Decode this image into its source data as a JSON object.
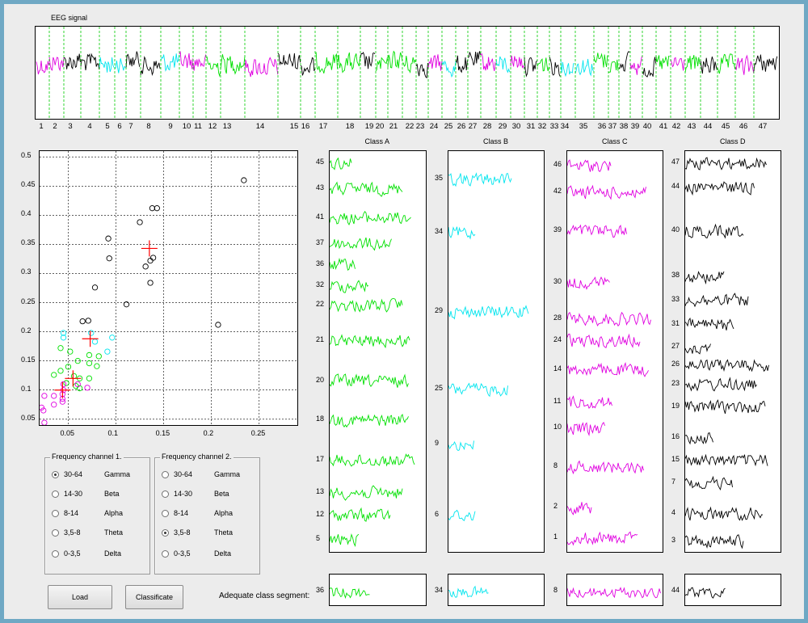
{
  "eeg": {
    "title": "EEG signal",
    "segments": [
      {
        "label": "1",
        "cls": "C"
      },
      {
        "label": "2",
        "cls": "C"
      },
      {
        "label": "3",
        "cls": "D"
      },
      {
        "label": "4",
        "cls": "D"
      },
      {
        "label": "5",
        "cls": "B"
      },
      {
        "label": "6",
        "cls": "B"
      },
      {
        "label": "7",
        "cls": "D"
      },
      {
        "label": "8",
        "cls": "D"
      },
      {
        "label": "9",
        "cls": "B"
      },
      {
        "label": "10",
        "cls": "C"
      },
      {
        "label": "11",
        "cls": "C"
      },
      {
        "label": "12",
        "cls": "A"
      },
      {
        "label": "13",
        "cls": "A"
      },
      {
        "label": "14",
        "cls": "C"
      },
      {
        "label": "15",
        "cls": "D"
      },
      {
        "label": "16",
        "cls": "D"
      },
      {
        "label": "17",
        "cls": "A"
      },
      {
        "label": "18",
        "cls": "A"
      },
      {
        "label": "19",
        "cls": "D"
      },
      {
        "label": "20",
        "cls": "A"
      },
      {
        "label": "21",
        "cls": "A"
      },
      {
        "label": "22",
        "cls": "A"
      },
      {
        "label": "23",
        "cls": "D"
      },
      {
        "label": "24",
        "cls": "C"
      },
      {
        "label": "25",
        "cls": "B"
      },
      {
        "label": "26",
        "cls": "D"
      },
      {
        "label": "27",
        "cls": "D"
      },
      {
        "label": "28",
        "cls": "C"
      },
      {
        "label": "29",
        "cls": "B"
      },
      {
        "label": "30",
        "cls": "C"
      },
      {
        "label": "31",
        "cls": "D"
      },
      {
        "label": "32",
        "cls": "A"
      },
      {
        "label": "33",
        "cls": "D"
      },
      {
        "label": "34",
        "cls": "B"
      },
      {
        "label": "35",
        "cls": "B"
      },
      {
        "label": "36",
        "cls": "A"
      },
      {
        "label": "37",
        "cls": "A"
      },
      {
        "label": "38",
        "cls": "D"
      },
      {
        "label": "39",
        "cls": "C"
      },
      {
        "label": "40",
        "cls": "D"
      },
      {
        "label": "41",
        "cls": "A"
      },
      {
        "label": "42",
        "cls": "C"
      },
      {
        "label": "43",
        "cls": "A"
      },
      {
        "label": "44",
        "cls": "D"
      },
      {
        "label": "45",
        "cls": "A"
      },
      {
        "label": "46",
        "cls": "C"
      },
      {
        "label": "47",
        "cls": "D"
      }
    ]
  },
  "colors": {
    "A": "#00e000",
    "B": "#00e5ee",
    "C": "#e000e0",
    "D": "#000000",
    "centroid": "#ff0000"
  },
  "scatter": {
    "x_ticks": [
      "0.05",
      "0.1",
      "0.15",
      "0.2",
      "0.25"
    ],
    "y_ticks": [
      "0.5",
      "0.45",
      "0.4",
      "0.35",
      "0.3",
      "0.25",
      "0.2",
      "0.15",
      "0.1",
      "0.05"
    ],
    "xlim": [
      0.02,
      0.29
    ],
    "ylim": [
      0.04,
      0.51
    ],
    "grid": true,
    "points": [
      {
        "c": "D",
        "x": 0.234,
        "y": 0.46
      },
      {
        "c": "D",
        "x": 0.138,
        "y": 0.412
      },
      {
        "c": "D",
        "x": 0.143,
        "y": 0.412
      },
      {
        "c": "D",
        "x": 0.125,
        "y": 0.388
      },
      {
        "c": "D",
        "x": 0.092,
        "y": 0.36
      },
      {
        "c": "D",
        "x": 0.093,
        "y": 0.326
      },
      {
        "c": "D",
        "x": 0.131,
        "y": 0.312
      },
      {
        "c": "D",
        "x": 0.136,
        "y": 0.322
      },
      {
        "c": "D",
        "x": 0.139,
        "y": 0.327
      },
      {
        "c": "D",
        "x": 0.136,
        "y": 0.284
      },
      {
        "c": "D",
        "x": 0.078,
        "y": 0.276
      },
      {
        "c": "D",
        "x": 0.111,
        "y": 0.247
      },
      {
        "c": "D",
        "x": 0.065,
        "y": 0.218
      },
      {
        "c": "D",
        "x": 0.071,
        "y": 0.219
      },
      {
        "c": "D",
        "x": 0.207,
        "y": 0.212
      },
      {
        "c": "B",
        "x": 0.045,
        "y": 0.198
      },
      {
        "c": "B",
        "x": 0.074,
        "y": 0.198
      },
      {
        "c": "B",
        "x": 0.045,
        "y": 0.19
      },
      {
        "c": "B",
        "x": 0.096,
        "y": 0.19
      },
      {
        "c": "B",
        "x": 0.078,
        "y": 0.183
      },
      {
        "c": "B",
        "x": 0.091,
        "y": 0.166
      },
      {
        "c": "A",
        "x": 0.042,
        "y": 0.172
      },
      {
        "c": "A",
        "x": 0.052,
        "y": 0.166
      },
      {
        "c": "A",
        "x": 0.072,
        "y": 0.16
      },
      {
        "c": "A",
        "x": 0.082,
        "y": 0.158
      },
      {
        "c": "A",
        "x": 0.06,
        "y": 0.15
      },
      {
        "c": "A",
        "x": 0.072,
        "y": 0.146
      },
      {
        "c": "A",
        "x": 0.08,
        "y": 0.141
      },
      {
        "c": "A",
        "x": 0.05,
        "y": 0.14
      },
      {
        "c": "A",
        "x": 0.042,
        "y": 0.133
      },
      {
        "c": "A",
        "x": 0.035,
        "y": 0.126
      },
      {
        "c": "A",
        "x": 0.056,
        "y": 0.124
      },
      {
        "c": "A",
        "x": 0.062,
        "y": 0.12
      },
      {
        "c": "A",
        "x": 0.072,
        "y": 0.12
      },
      {
        "c": "A",
        "x": 0.048,
        "y": 0.112
      },
      {
        "c": "A",
        "x": 0.058,
        "y": 0.107
      },
      {
        "c": "A",
        "x": 0.062,
        "y": 0.103
      },
      {
        "c": "C",
        "x": 0.045,
        "y": 0.11
      },
      {
        "c": "C",
        "x": 0.06,
        "y": 0.11
      },
      {
        "c": "C",
        "x": 0.045,
        "y": 0.1
      },
      {
        "c": "C",
        "x": 0.07,
        "y": 0.104
      },
      {
        "c": "C",
        "x": 0.044,
        "y": 0.093
      },
      {
        "c": "C",
        "x": 0.035,
        "y": 0.09
      },
      {
        "c": "C",
        "x": 0.025,
        "y": 0.09
      },
      {
        "c": "C",
        "x": 0.044,
        "y": 0.085
      },
      {
        "c": "C",
        "x": 0.035,
        "y": 0.075
      },
      {
        "c": "C",
        "x": 0.044,
        "y": 0.08
      },
      {
        "c": "C",
        "x": 0.022,
        "y": 0.07
      },
      {
        "c": "C",
        "x": 0.024,
        "y": 0.065
      },
      {
        "c": "C",
        "x": 0.025,
        "y": 0.044
      }
    ],
    "centroids": [
      {
        "c": "D",
        "x": 0.135,
        "y": 0.343
      },
      {
        "c": "B",
        "x": 0.073,
        "y": 0.188
      },
      {
        "c": "A",
        "x": 0.055,
        "y": 0.12
      },
      {
        "c": "C",
        "x": 0.044,
        "y": 0.1
      }
    ]
  },
  "radio1": {
    "title": "Frequency channel 1.",
    "options": [
      {
        "range": "30-64",
        "name": "Gamma",
        "selected": true
      },
      {
        "range": "14-30",
        "name": "Beta",
        "selected": false
      },
      {
        "range": "8-14",
        "name": "Alpha",
        "selected": false
      },
      {
        "range": "3,5-8",
        "name": "Theta",
        "selected": false
      },
      {
        "range": "0-3,5",
        "name": "Delta",
        "selected": false
      }
    ]
  },
  "radio2": {
    "title": "Frequency channel 2.",
    "options": [
      {
        "range": "30-64",
        "name": "Gamma",
        "selected": false
      },
      {
        "range": "14-30",
        "name": "Beta",
        "selected": false
      },
      {
        "range": "8-14",
        "name": "Alpha",
        "selected": false
      },
      {
        "range": "3,5-8",
        "name": "Theta",
        "selected": true
      },
      {
        "range": "0-3,5",
        "name": "Delta",
        "selected": false
      }
    ]
  },
  "buttons": {
    "load": "Load",
    "classify": "Classificate"
  },
  "adequate_label": "Adequate class segment:",
  "classes": [
    {
      "title": "Class A",
      "color": "A",
      "labels": [
        "45",
        "43",
        "41",
        "37",
        "36",
        "32",
        "22",
        "21",
        "20",
        "18",
        "17",
        "13",
        "12",
        "5"
      ],
      "adequate": "36"
    },
    {
      "title": "Class B",
      "color": "B",
      "labels": [
        "35",
        "34",
        "29",
        "25",
        "9",
        "6"
      ],
      "adequate": "34"
    },
    {
      "title": "Class C",
      "color": "C",
      "labels": [
        "46",
        "42",
        "39",
        "30",
        "28",
        "24",
        "14",
        "11",
        "10",
        "8",
        "2",
        "1"
      ],
      "adequate": "8"
    },
    {
      "title": "Class D",
      "color": "D",
      "labels": [
        "47",
        "44",
        "40",
        "38",
        "33",
        "31",
        "27",
        "26",
        "23",
        "19",
        "16",
        "15",
        "7",
        "4",
        "3"
      ],
      "adequate": "44"
    }
  ]
}
